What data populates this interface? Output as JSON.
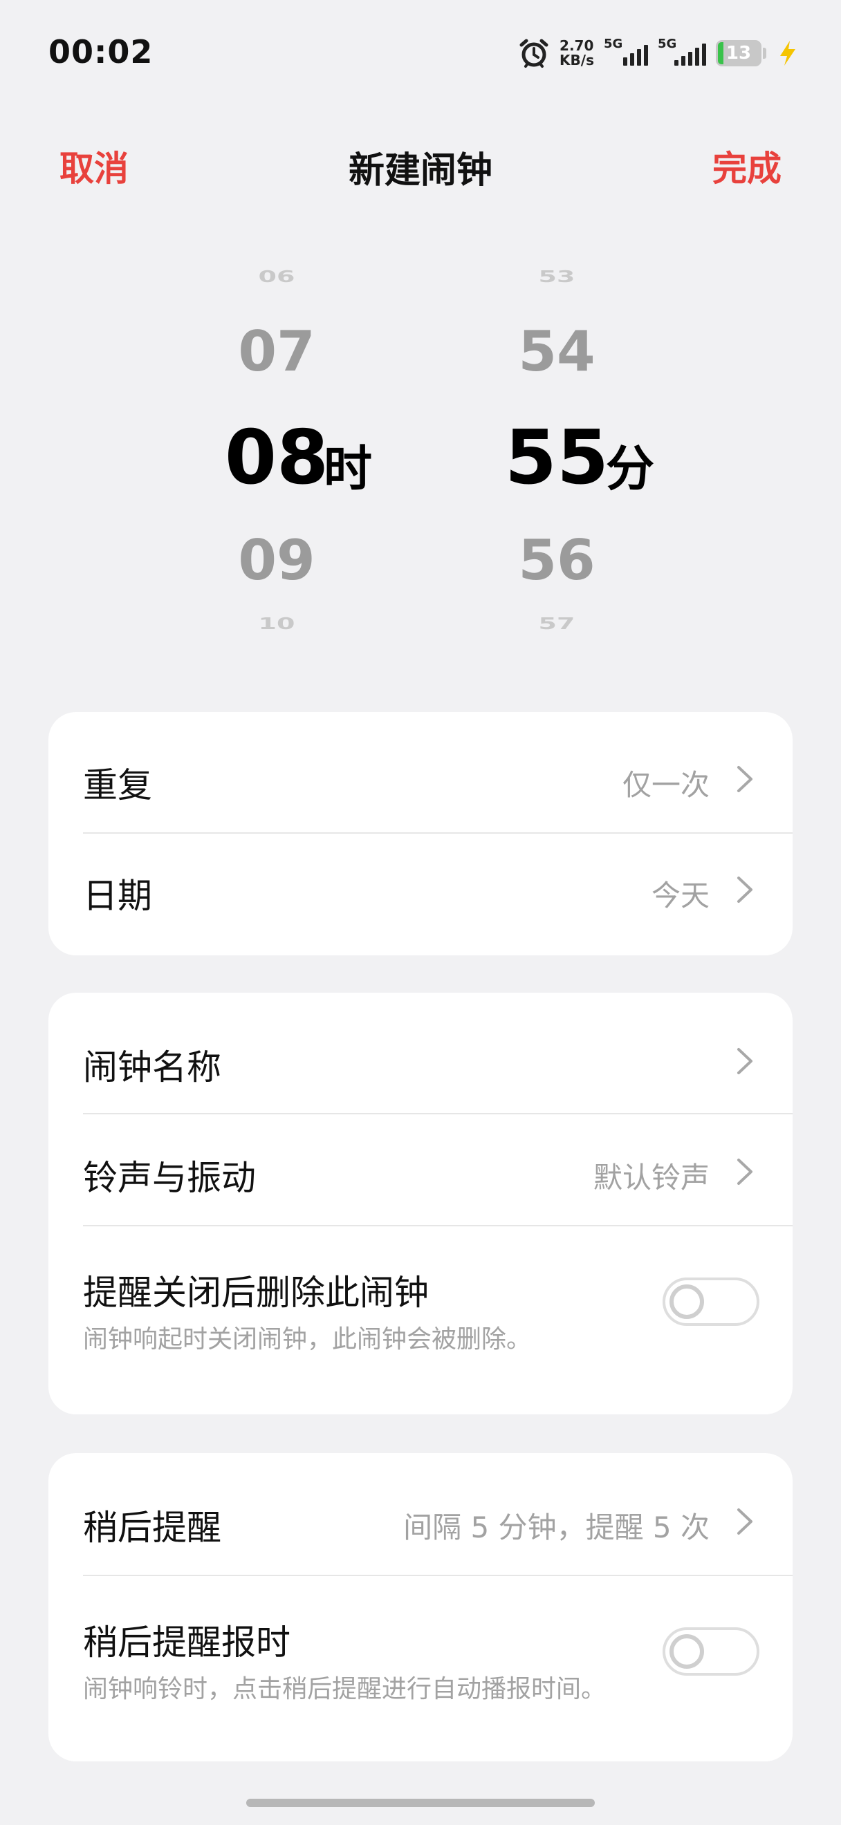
{
  "status_bar": {
    "time": "00:02",
    "speed_value": "2.70",
    "speed_unit": "KB/s",
    "net1": "5G",
    "net2": "5G",
    "battery": "13",
    "accent_charging": "#f5c400"
  },
  "header": {
    "cancel": "取消",
    "title": "新建闹钟",
    "done": "完成",
    "accent": "#e8413c"
  },
  "picker": {
    "hours": {
      "prev2": "06",
      "prev1": "07",
      "selected": "08",
      "next1": "09",
      "next2": "10",
      "unit": "时"
    },
    "minutes": {
      "prev2": "53",
      "prev1": "54",
      "selected": "55",
      "next1": "56",
      "next2": "57",
      "unit": "分"
    }
  },
  "card1": {
    "repeat": {
      "label": "重复",
      "value": "仅一次"
    },
    "date": {
      "label": "日期",
      "value": "今天"
    }
  },
  "card2": {
    "name": {
      "label": "闹钟名称"
    },
    "ringtone": {
      "label": "铃声与振动",
      "value": "默认铃声"
    },
    "delete_after": {
      "label": "提醒关闭后删除此闹钟",
      "sub": "闹钟响起时关闭闹钟，此闹钟会被删除。",
      "enabled": false
    }
  },
  "card3": {
    "snooze": {
      "label": "稍后提醒",
      "value": "间隔 5 分钟，提醒 5 次"
    },
    "snooze_announce": {
      "label": "稍后提醒报时",
      "sub": "闹钟响铃时，点击稍后提醒进行自动播报时间。",
      "enabled": false
    }
  }
}
